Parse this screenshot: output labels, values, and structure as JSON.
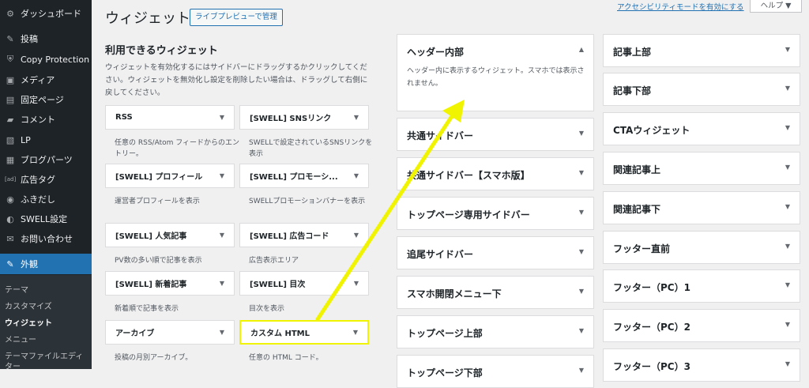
{
  "sidebar": {
    "top_items": [
      {
        "label": "ダッシュボード",
        "icon": "dashboard-icon",
        "glyph": "⚙"
      },
      {
        "label": "投稿",
        "icon": "pin-icon",
        "glyph": "✎"
      },
      {
        "label": "Copy Protection",
        "icon": "shield-icon",
        "glyph": "⛨"
      },
      {
        "label": "メディア",
        "icon": "media-icon",
        "glyph": "▣"
      },
      {
        "label": "固定ページ",
        "icon": "page-icon",
        "glyph": "▤"
      },
      {
        "label": "コメント",
        "icon": "comment-icon",
        "glyph": "▰"
      },
      {
        "label": "LP",
        "icon": "lp-icon",
        "glyph": "▧"
      },
      {
        "label": "ブログパーツ",
        "icon": "blocks-icon",
        "glyph": "▦"
      },
      {
        "label": "広告タグ",
        "icon": "ad-icon",
        "glyph": "[ad]"
      },
      {
        "label": "ふきだし",
        "icon": "speech-bubble-icon",
        "glyph": "◉"
      },
      {
        "label": "SWELL設定",
        "icon": "swell-icon",
        "glyph": "◐"
      },
      {
        "label": "お問い合わせ",
        "icon": "mail-icon",
        "glyph": "✉"
      },
      {
        "label": "外観",
        "icon": "appearance-icon",
        "glyph": "✎"
      }
    ],
    "sub_items": [
      "テーマ",
      "カスタマイズ",
      "ウィジェット",
      "メニュー",
      "テーマファイルエディ",
      "ター"
    ]
  },
  "header": {
    "title": "ウィジェット",
    "preview_button": "ライブプレビューで管理",
    "a11y_link": "アクセシビリティモードを有効にする",
    "help": "ヘルプ ▼"
  },
  "available": {
    "heading": "利用できるウィジェット",
    "description": "ウィジェットを有効化するにはサイドバーにドラッグするかクリックしてください。ウィジェットを無効化し設定を削除したい場合は、ドラッグして右側に戻してください。",
    "widgets": [
      {
        "label": "RSS",
        "desc": "任意の RSS/Atom フィードからのエントリー。"
      },
      {
        "label": "[SWELL] SNSリンク",
        "desc": "SWELLで設定されているSNSリンクを表示"
      },
      {
        "label": "[SWELL] プロフィール",
        "desc": "運営者プロフィールを表示"
      },
      {
        "label": "[SWELL] プロモーシ...",
        "desc": "SWELLプロモーションバナーを表示"
      },
      {
        "label": "[SWELL] 人気記事",
        "desc": "PV数の多い順で記事を表示"
      },
      {
        "label": "[SWELL] 広告コード",
        "desc": "広告表示エリア"
      },
      {
        "label": "[SWELL] 新着記事",
        "desc": "新着順で記事を表示"
      },
      {
        "label": "[SWELL] 目次",
        "desc": "目次を表示"
      },
      {
        "label": "アーカイブ",
        "desc": "投稿の月別アーカイブ。"
      },
      {
        "label": "カスタム HTML",
        "desc": "任意の HTML コード。"
      }
    ]
  },
  "areas_col1": [
    {
      "label": "ヘッダー内部",
      "desc": "ヘッダー内に表示するウィジェット。スマホでは表示されません。",
      "open": true
    },
    {
      "label": "共通サイドバー"
    },
    {
      "label": "共通サイドバー【スマホ版】"
    },
    {
      "label": "トップページ専用サイドバー"
    },
    {
      "label": "追尾サイドバー"
    },
    {
      "label": "スマホ開閉メニュー下"
    },
    {
      "label": "トップページ上部"
    },
    {
      "label": "トップページ下部"
    }
  ],
  "areas_col2": [
    {
      "label": "記事上部"
    },
    {
      "label": "記事下部"
    },
    {
      "label": "CTAウィジェット"
    },
    {
      "label": "関連記事上"
    },
    {
      "label": "関連記事下"
    },
    {
      "label": "フッター直前"
    },
    {
      "label": "フッター（PC）1"
    },
    {
      "label": "フッター（PC）2"
    },
    {
      "label": "フッター（PC）3"
    }
  ],
  "colors": {
    "sidebar_bg": "#1d2327",
    "accent": "#2271b1",
    "annotation": "#f0f400"
  }
}
